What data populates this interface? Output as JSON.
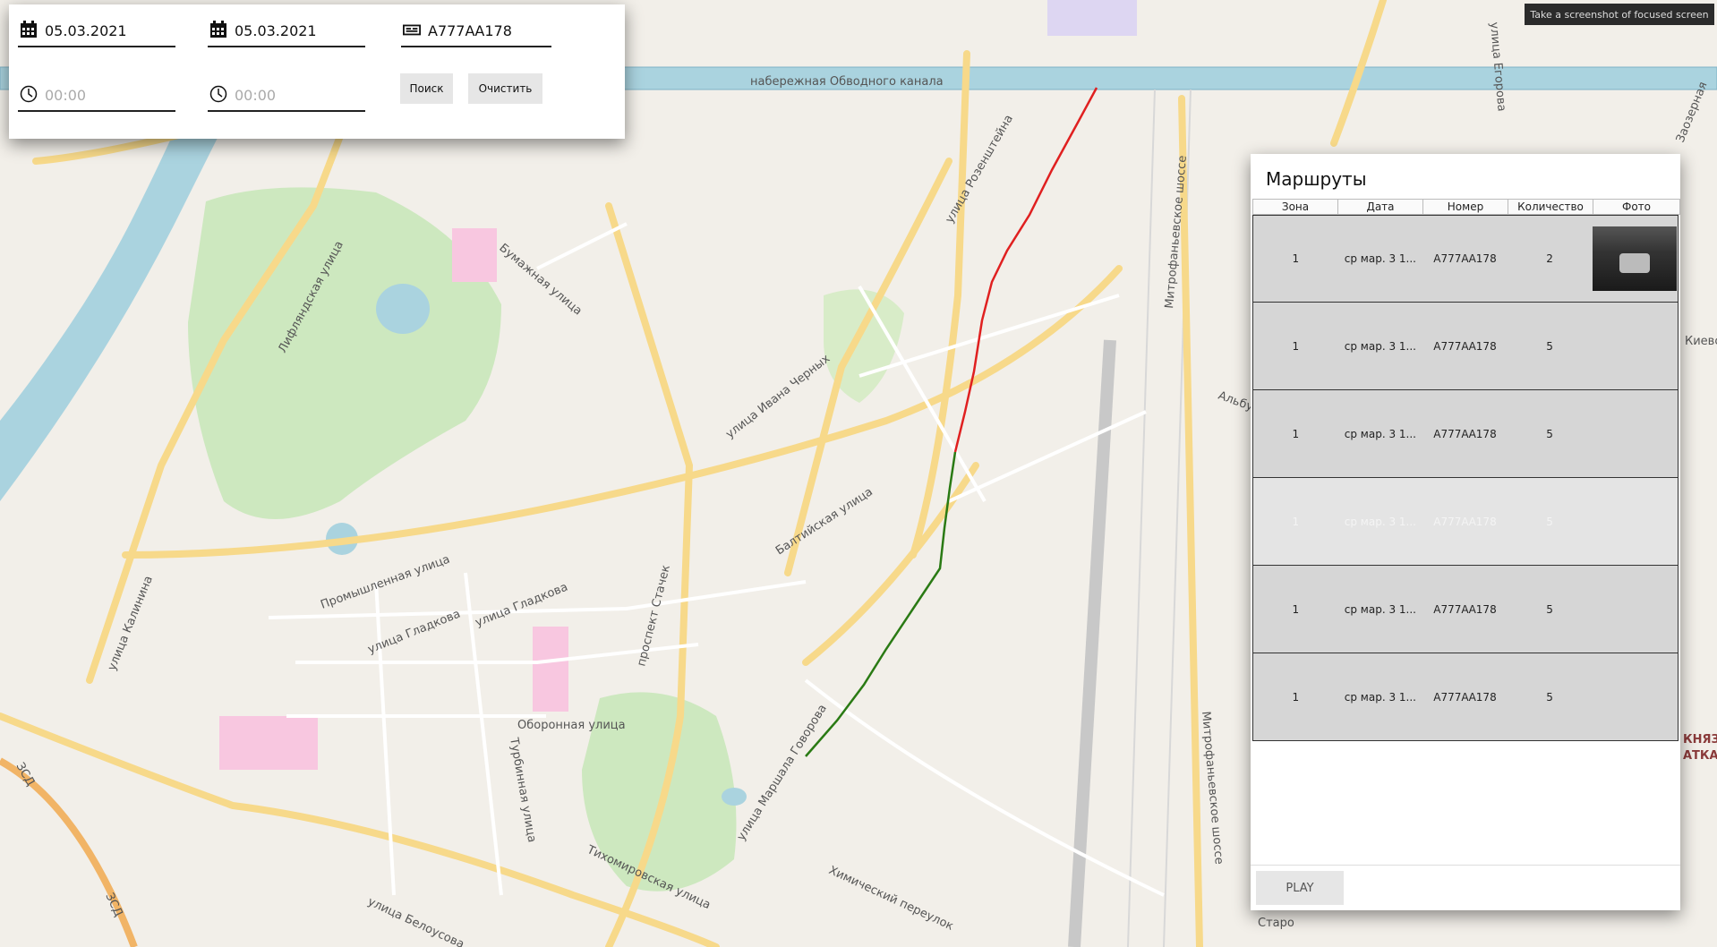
{
  "map": {
    "street_labels": [
      "набережная Обводного канала",
      "Бумажная улица",
      "Лифляндская улица",
      "улица Розенштейна",
      "улица Ивана Черных",
      "Балтийская улица",
      "Промышленная улица",
      "улица Гладкова",
      "улица Гладкова",
      "проспект Стачек",
      "Оборонная улица",
      "Турбинная улица",
      "улица Маршала Говорова",
      "Тихомировская улица",
      "Химический переулок",
      "Митрофаньевское шоссе",
      "Митрофаньевское шоссе",
      "улица Калинина",
      "улица Белоусова",
      "ЗСД",
      "ЗСД",
      "улица Егорова",
      "Заозерная",
      "Киевск",
      "Альбу",
      "Старо",
      "КНЯЗ",
      "АТКА"
    ],
    "route_colors": {
      "first": "#e02020",
      "second": "#2a7a14"
    }
  },
  "search": {
    "date_from": "05.03.2021",
    "date_to": "05.03.2021",
    "plate": "А777АА178",
    "time_from_placeholder": "00:00",
    "time_to_placeholder": "00:00",
    "search_button": "Поиск",
    "clear_button": "Очистить"
  },
  "tooltip": "Take a screenshot of focused screen",
  "routes": {
    "title": "Маршруты",
    "columns": [
      "Зона",
      "Дата",
      "Номер",
      "Количество",
      "Фото"
    ],
    "rows": [
      {
        "zone": "1",
        "date": "ср мар. 3 1...",
        "number": "А777АА178",
        "count": "2",
        "has_photo": true
      },
      {
        "zone": "1",
        "date": "ср мар. 3 1...",
        "number": "А777АА178",
        "count": "5",
        "has_photo": false
      },
      {
        "zone": "1",
        "date": "ср мар. 3 1...",
        "number": "А777АА178",
        "count": "5",
        "has_photo": false
      },
      {
        "zone": "1",
        "date": "ср мар. 3 1...",
        "number": "А777АА178",
        "count": "5",
        "has_photo": false
      },
      {
        "zone": "1",
        "date": "ср мар. 3 1...",
        "number": "А777АА178",
        "count": "5",
        "has_photo": false
      },
      {
        "zone": "1",
        "date": "ср мар. 3 1...",
        "number": "А777АА178",
        "count": "5",
        "has_photo": false
      }
    ],
    "play_button": "PLAY"
  }
}
